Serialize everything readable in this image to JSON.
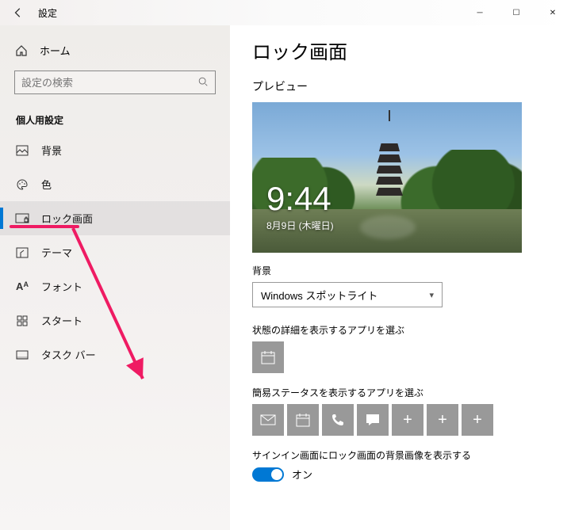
{
  "window": {
    "title": "設定",
    "controls": {
      "min": "─",
      "max": "☐",
      "close": "✕"
    }
  },
  "sidebar": {
    "home": "ホーム",
    "search_placeholder": "設定の検索",
    "category": "個人用設定",
    "items": [
      {
        "label": "背景",
        "icon": "picture-icon"
      },
      {
        "label": "色",
        "icon": "palette-icon"
      },
      {
        "label": "ロック画面",
        "icon": "lockscreen-icon"
      },
      {
        "label": "テーマ",
        "icon": "theme-icon"
      },
      {
        "label": "フォント",
        "icon": "font-icon"
      },
      {
        "label": "スタート",
        "icon": "start-icon"
      },
      {
        "label": "タスク バー",
        "icon": "taskbar-icon"
      }
    ],
    "active_index": 2
  },
  "main": {
    "title": "ロック画面",
    "preview_label": "プレビュー",
    "clock": {
      "time": "9:44",
      "date": "8月9日 (木曜日)"
    },
    "background_label": "背景",
    "background_value": "Windows スポットライト",
    "detailed_label": "状態の詳細を表示するアプリを選ぶ",
    "quick_label": "簡易ステータスを表示するアプリを選ぶ",
    "quick_icons": [
      "mail-icon",
      "calendar-icon",
      "phone-icon",
      "chat-icon",
      "plus-icon",
      "plus-icon",
      "plus-icon"
    ],
    "signin_label": "サインイン画面にロック画面の背景画像を表示する",
    "toggle_text": "オン"
  }
}
